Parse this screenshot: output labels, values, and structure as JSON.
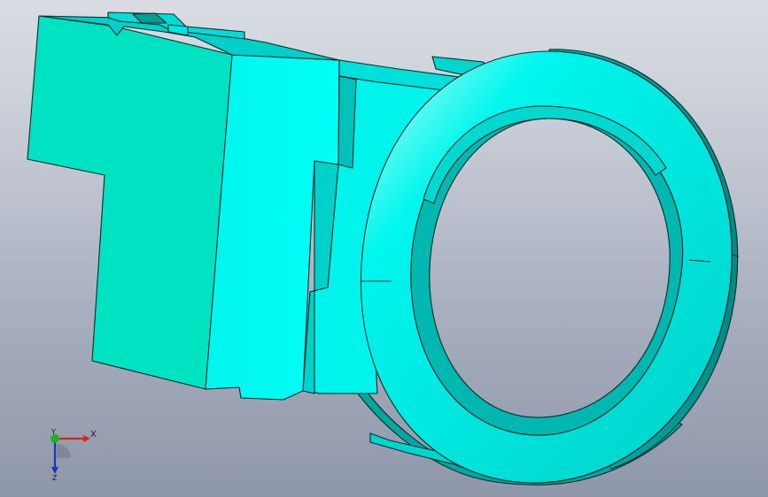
{
  "viewport": {
    "background_top": "#dadde3",
    "background_bottom": "#8e97a9"
  },
  "model": {
    "face_colors": {
      "front": "#00e3c2",
      "side_bright": "#00fff0",
      "side_mid": "#00d8d2",
      "side_dark": "#00a8a2",
      "ring_face": "#00f0e8",
      "ring_inner": "#00b9b4",
      "edge": "#0a2a2a"
    }
  },
  "triad": {
    "x_label": "X",
    "y_label": "Y",
    "z_label": "Z",
    "x_color": "#e02020",
    "y_color": "#20b020",
    "z_color": "#2030c0"
  }
}
